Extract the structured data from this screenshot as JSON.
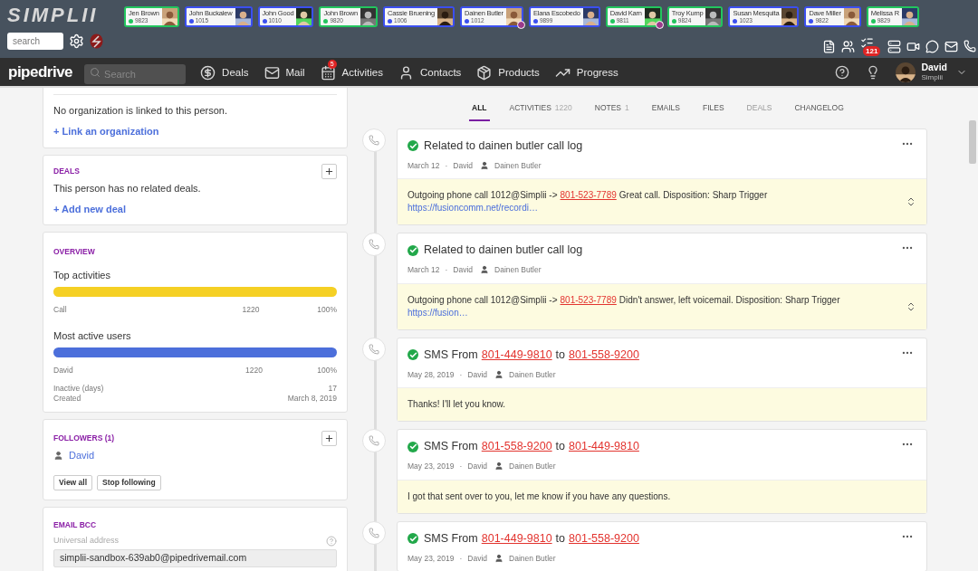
{
  "topbar": {
    "logo": "SIMPLII",
    "search": {
      "placeholder": "search"
    },
    "contacts": [
      {
        "name": "Jen Brown",
        "ext": "9823",
        "color": "#22c55e",
        "busy": false
      },
      {
        "name": "John Buckalew",
        "ext": "1015",
        "color": "#3b4ff0",
        "busy": false
      },
      {
        "name": "John Good",
        "ext": "1010",
        "color": "#3b4ff0",
        "busy": false
      },
      {
        "name": "John Brown",
        "ext": "9820",
        "color": "#22c55e",
        "busy": false
      },
      {
        "name": "Cassie Bruening",
        "ext": "1006",
        "color": "#3b4ff0",
        "busy": false
      },
      {
        "name": "Dainen Butler",
        "ext": "1012",
        "color": "#3b4ff0",
        "busy": true
      },
      {
        "name": "Elana Escobedo",
        "ext": "9899",
        "color": "#3b4ff0",
        "busy": false
      },
      {
        "name": "David Karn",
        "ext": "9811",
        "color": "#22c55e",
        "busy": true
      },
      {
        "name": "Troy Kump",
        "ext": "9824",
        "color": "#22c55e",
        "busy": false
      },
      {
        "name": "Susan Mesquita",
        "ext": "1023",
        "color": "#3b4ff0",
        "busy": false
      },
      {
        "name": "Dave Miller",
        "ext": "9822",
        "color": "#3b4ff0",
        "busy": false
      },
      {
        "name": "Melissa R",
        "ext": "9829",
        "color": "#22c55e",
        "busy": false
      }
    ],
    "tasks_badge": "121"
  },
  "nav": {
    "logo": "pipedrive",
    "search": {
      "placeholder": "Search"
    },
    "items": [
      {
        "label": "Deals"
      },
      {
        "label": "Mail"
      },
      {
        "label": "Activities",
        "badge": "5"
      },
      {
        "label": "Contacts"
      },
      {
        "label": "Products"
      },
      {
        "label": "Progress"
      }
    ],
    "user": {
      "name": "David",
      "company": "Simplii"
    }
  },
  "sidebar": {
    "organization": {
      "text": "No organization is linked to this person.",
      "link": "+ Link an organization"
    },
    "deals": {
      "title": "DEALS",
      "text": "This person has no related deals.",
      "link": "+ Add new deal"
    },
    "overview": {
      "title": "OVERVIEW",
      "stats": [
        {
          "title": "Top activities",
          "color": "#f5d024",
          "level": 1,
          "label": "Call",
          "count": "1220",
          "percent": "100%"
        },
        {
          "title": "Most active users",
          "color": "#4c6fdb",
          "level": 1,
          "label": "David",
          "count": "1220",
          "percent": "100%"
        }
      ],
      "facts": [
        {
          "label": "Inactive (days)",
          "value": "17"
        },
        {
          "label": "Created",
          "value": "March 8, 2019"
        }
      ]
    },
    "followers": {
      "title": "FOLLOWERS (1)",
      "people": [
        "David"
      ],
      "buttons": [
        "View all",
        "Stop following"
      ]
    },
    "email_bcc": {
      "title": "EMAIL BCC",
      "label": "Universal address",
      "value": "simplii-sandbox-639ab0@pipedrivemail.com"
    }
  },
  "tabs": [
    {
      "label": "ALL",
      "selected": true,
      "disabled": false
    },
    {
      "label": "ACTIVITIES",
      "count": "1220",
      "selected": false,
      "disabled": false
    },
    {
      "label": "NOTES",
      "count": "1",
      "selected": false,
      "disabled": false
    },
    {
      "label": "EMAILS",
      "selected": false,
      "disabled": false
    },
    {
      "label": "FILES",
      "selected": false,
      "disabled": false
    },
    {
      "label": "DEALS",
      "selected": false,
      "disabled": true
    },
    {
      "label": "CHANGELOG",
      "selected": false,
      "disabled": false
    }
  ],
  "feed": [
    {
      "done": true,
      "title": [
        {
          "kind": "text",
          "text": "Related to dainen butler call log"
        }
      ],
      "date": "March 12",
      "separator": "·",
      "user": "David",
      "person": "Dainen Butler",
      "expandable": true,
      "body": [
        {
          "kind": "text",
          "text": "Outgoing phone call 1012@Simplii ->"
        },
        {
          "kind": "phone",
          "text": "801-523-7789"
        },
        {
          "kind": "text",
          "text": "Great call. Disposition: Sharp Trigger"
        },
        {
          "kind": "url",
          "text": "https://fusioncomm.net/recordi…"
        }
      ]
    },
    {
      "done": true,
      "title": [
        {
          "kind": "text",
          "text": "Related to dainen butler call log"
        }
      ],
      "date": "March 12",
      "separator": "·",
      "user": "David",
      "person": "Dainen Butler",
      "expandable": true,
      "body": [
        {
          "kind": "text",
          "text": "Outgoing phone call 1012@Simplii ->"
        },
        {
          "kind": "phone",
          "text": "801-523-7789"
        },
        {
          "kind": "text",
          "text": "Didn't answer, left voicemail. Disposition: Sharp Trigger"
        },
        {
          "kind": "url",
          "text": "https://fusion…"
        }
      ]
    },
    {
      "done": true,
      "title": [
        {
          "kind": "text",
          "text": "SMS From"
        },
        {
          "kind": "phone",
          "text": "801-449-9810"
        },
        {
          "kind": "text",
          "text": "to"
        },
        {
          "kind": "phone",
          "text": "801-558-9200"
        }
      ],
      "date": "May 28, 2019",
      "separator": "·",
      "user": "David",
      "person": "Dainen Butler",
      "expandable": false,
      "body": [
        {
          "kind": "text",
          "text": "Thanks! I'll let you know."
        }
      ]
    },
    {
      "done": true,
      "title": [
        {
          "kind": "text",
          "text": "SMS From"
        },
        {
          "kind": "phone",
          "text": "801-558-9200"
        },
        {
          "kind": "text",
          "text": "to"
        },
        {
          "kind": "phone",
          "text": "801-449-9810"
        }
      ],
      "date": "May 23, 2019",
      "separator": "·",
      "user": "David",
      "person": "Dainen Butler",
      "expandable": false,
      "body": [
        {
          "kind": "text",
          "text": "I got that sent over to you, let me know if you have any questions."
        }
      ]
    },
    {
      "done": true,
      "title": [
        {
          "kind": "text",
          "text": "SMS From"
        },
        {
          "kind": "phone",
          "text": "801-449-9810"
        },
        {
          "kind": "text",
          "text": "to"
        },
        {
          "kind": "phone",
          "text": "801-558-9200"
        }
      ],
      "date": "May 23, 2019",
      "separator": "·",
      "user": "David",
      "person": "Dainen Butler"
    }
  ]
}
